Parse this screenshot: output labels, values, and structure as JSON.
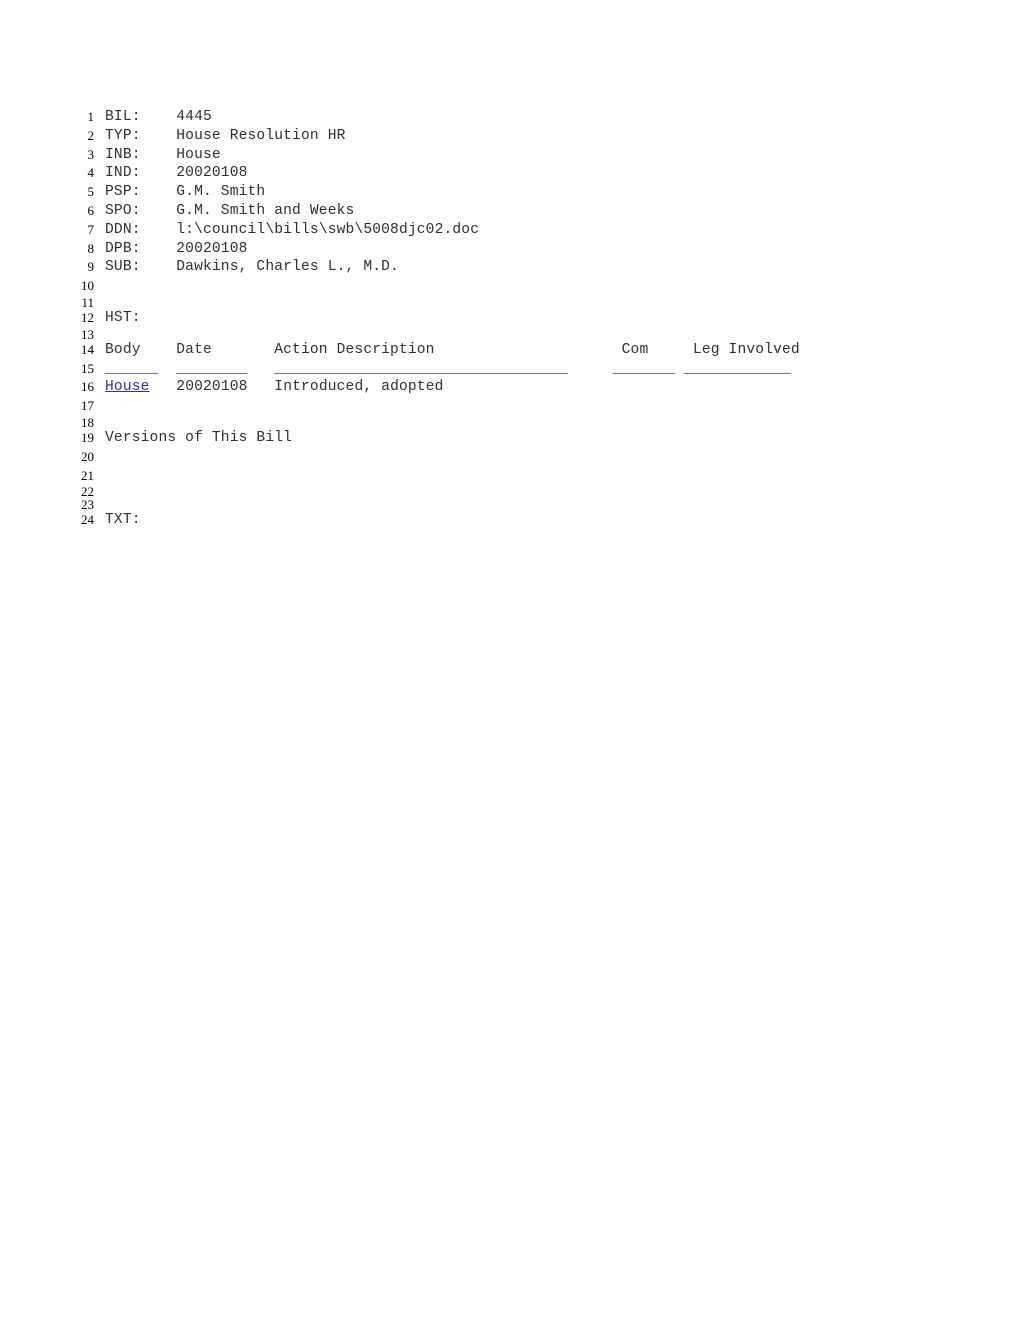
{
  "document": {
    "kind": "legislative-bill-record",
    "link_color": "#2c2cc8",
    "text_color": "#303030"
  },
  "fields": {
    "bil_label": "BIL:",
    "bil_value": "4445",
    "typ_label": "TYP:",
    "typ_value": "House Resolution HR",
    "inb_label": "INB:",
    "inb_value": "House",
    "ind_label": "IND:",
    "ind_value": "20020108",
    "psp_label": "PSP:",
    "psp_value": "G.M. Smith",
    "spo_label": "SPO:",
    "spo_value": "G.M. Smith and Weeks",
    "ddn_label": "DDN:",
    "ddn_value": "l:\\council\\bills\\swb\\5008djc02.doc",
    "dpb_label": "DPB:",
    "dpb_value": "20020108",
    "sub_label": "SUB:",
    "sub_value": "Dawkins, Charles L., M.D.",
    "hst_label": "HST:",
    "txt_label": "TXT:"
  },
  "history_table": {
    "headers": {
      "body": "Body",
      "date": "Date",
      "action": "Action Description",
      "com": "Com",
      "leg": "Leg Involved"
    },
    "rules": {
      "body": "______",
      "date": "________",
      "action": "_________________________________",
      "com": "_______",
      "leg": "____________"
    },
    "rows": [
      {
        "body": "House",
        "date": "20020108",
        "action": "Introduced, adopted",
        "com": "",
        "leg": ""
      }
    ]
  },
  "sections": {
    "versions_heading": "Versions of This Bill"
  },
  "lines": [
    {
      "n": "1",
      "text": "BIL:    4445"
    },
    {
      "n": "2",
      "text": "TYP:    House Resolution HR"
    },
    {
      "n": "3",
      "text": "INB:    House"
    },
    {
      "n": "4",
      "text": "IND:    20020108"
    },
    {
      "n": "5",
      "text": "PSP:    G.M. Smith"
    },
    {
      "n": "6",
      "text": "SPO:    G.M. Smith and Weeks"
    },
    {
      "n": "7",
      "text": "DDN:    l:\\council\\bills\\swb\\5008djc02.doc"
    },
    {
      "n": "8",
      "text": "DPB:    20020108"
    },
    {
      "n": "9",
      "text": "SUB:    Dawkins, Charles L., M.D."
    },
    {
      "n": "10",
      "text": ""
    },
    {
      "n": "11",
      "text": ""
    },
    {
      "n": "12",
      "text": "HST:"
    },
    {
      "n": "13",
      "text": ""
    },
    {
      "n": "14",
      "text": "Body    Date       Action Description                     Com     Leg Involved"
    },
    {
      "n": "15",
      "text": "______  ________   _________________________________     _______ ____________"
    },
    {
      "n": "16",
      "text": "House   20020108   Introduced, adopted"
    },
    {
      "n": "17",
      "text": ""
    },
    {
      "n": "18",
      "text": ""
    },
    {
      "n": "19",
      "text": "Versions of This Bill"
    },
    {
      "n": "20",
      "text": ""
    },
    {
      "n": "21",
      "text": ""
    },
    {
      "n": "22",
      "text": ""
    },
    {
      "n": "23",
      "text": ""
    },
    {
      "n": "24",
      "text": "TXT:"
    }
  ]
}
